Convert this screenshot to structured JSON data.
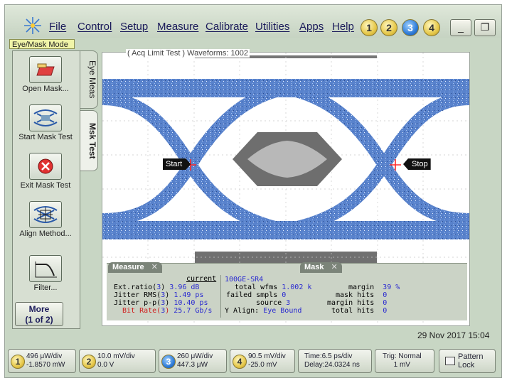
{
  "menubar": {
    "items": [
      "File",
      "Control",
      "Setup",
      "Measure",
      "Calibrate",
      "Utilities",
      "Apps",
      "Help"
    ],
    "channels": [
      "1",
      "2",
      "3",
      "4"
    ],
    "minimize_glyph": "_",
    "restore_glyph": "❐"
  },
  "mode_label": "Eye/Mask Mode",
  "left_tools": [
    {
      "label": "Open Mask..."
    },
    {
      "label": "Start Mask Test"
    },
    {
      "label": "Exit Mask Test"
    },
    {
      "label": "Align Method..."
    },
    {
      "label": "Filter..."
    }
  ],
  "more_button": {
    "line1": "More",
    "line2": "(1 of 2)"
  },
  "side_tabs": {
    "eye_meas": "Eye Meas",
    "mask_test": "Msk Test"
  },
  "display": {
    "title": "( Acq Limit Test )  Waveforms: 1002",
    "start_marker": "Start",
    "stop_marker": "Stop"
  },
  "measure_panel": {
    "tab_measure": "Measure",
    "tab_mask": "Mask",
    "col_header": "current",
    "rows": [
      {
        "name": "Ext.ratio(",
        "src": "3",
        "value": "3.96 dB"
      },
      {
        "name": "Jitter RMS(",
        "src": "3",
        "value": "1.49 ps"
      },
      {
        "name": "Jitter p-p(",
        "src": "3",
        "value": "10.40 ps"
      },
      {
        "name": "Bit Rate(",
        "src": "3",
        "value": "25.7 Gb/s"
      }
    ],
    "mask_name": "100GE-SR4",
    "mask_rows": [
      {
        "label": "total wfms",
        "value": "1.002 k"
      },
      {
        "label": "failed smpls",
        "value": "0"
      },
      {
        "label": "source",
        "value": "3"
      },
      {
        "label": "Y Align:",
        "value": "Eye Bound"
      }
    ],
    "mask_right": [
      {
        "label": "margin",
        "value": "39 %"
      },
      {
        "label": "mask hits",
        "value": "0"
      },
      {
        "label": "margin hits",
        "value": "0"
      },
      {
        "label": "total hits",
        "value": "0"
      }
    ]
  },
  "datetime": "29 Nov 2017  15:04",
  "status_bar": {
    "ch1": {
      "num": "1",
      "line1": "496 μW/div",
      "line2": "-1.8570 mW"
    },
    "ch2": {
      "num": "2",
      "line1": "10.0 mV/div",
      "line2": "0.0 V"
    },
    "ch3": {
      "num": "3",
      "line1": "260 μW/div",
      "line2": "447.3 μW"
    },
    "ch4": {
      "num": "4",
      "line1": "90.5 mV/div",
      "line2": "-25.0 mV"
    },
    "time": {
      "line1": "Time:6.5 ps/div",
      "line2": "Delay:24.0324 ns"
    },
    "trig": {
      "line1": "Trig: Normal",
      "line2": "1 mV"
    },
    "pattern_lock": {
      "line1": "Pattern",
      "line2": "Lock"
    }
  },
  "colors": {
    "trace": "#4a78c8",
    "mask_outer": "#6e6e6e",
    "mask_inner": "#b8b8b8",
    "marker": "#ff2a2a"
  }
}
